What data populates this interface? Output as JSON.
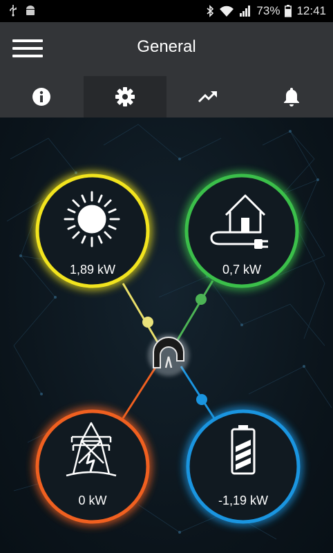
{
  "status_bar": {
    "battery_percent": "73%",
    "time": "12:41",
    "icons": [
      "usb-icon",
      "android-icon",
      "bluetooth-icon",
      "wifi-icon",
      "signal-icon",
      "battery-icon"
    ]
  },
  "header": {
    "title": "General"
  },
  "tabs": [
    {
      "name": "info",
      "icon": "info-icon",
      "active": false
    },
    {
      "name": "settings",
      "icon": "gear-icon",
      "active": true
    },
    {
      "name": "trends",
      "icon": "trending-up-icon",
      "active": false
    },
    {
      "name": "notifications",
      "icon": "bell-icon",
      "active": false
    }
  ],
  "energy_flow": {
    "solar": {
      "value": "1,89 kW",
      "icon": "sun-icon",
      "color": "#f2e41e"
    },
    "home": {
      "value": "0,7 kW",
      "icon": "house-plug-icon",
      "color": "#3bbf4a"
    },
    "grid": {
      "value": "0 kW",
      "icon": "power-tower-icon",
      "color": "#f06020"
    },
    "battery": {
      "value": "-1,19 kW",
      "icon": "battery-icon",
      "color": "#1a95e0"
    },
    "hub": {
      "icon": "hub-logo-icon"
    }
  }
}
